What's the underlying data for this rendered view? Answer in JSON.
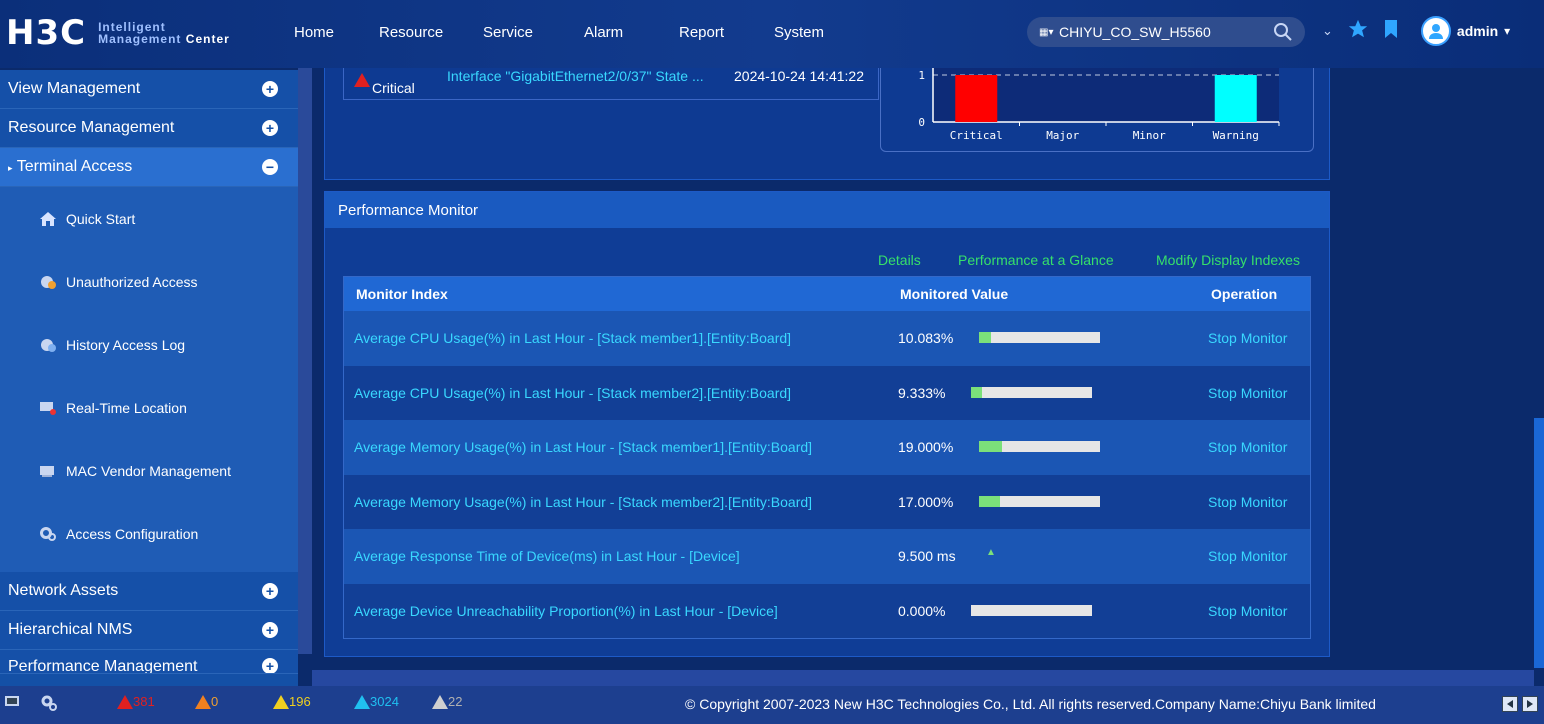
{
  "header": {
    "brand": "H3C",
    "brand_sub_line1": "Intelligent",
    "brand_sub_line2a": "Management",
    "brand_sub_line2b": "Center",
    "nav": [
      "Home",
      "Resource",
      "Service",
      "Alarm",
      "Report",
      "System"
    ],
    "device_selector": "CHIYU_CO_SW_H5560",
    "user": "admin"
  },
  "sidebar": {
    "sections": [
      "View Management",
      "Resource Management",
      "Terminal Access"
    ],
    "sub_items": [
      "Quick Start",
      "Unauthorized Access",
      "History Access Log",
      "Real-Time Location",
      "MAC Vendor Management",
      "Access Configuration"
    ],
    "bottom_sections": [
      "Network Assets",
      "Hierarchical NMS",
      "Performance Management"
    ]
  },
  "alarm_row": {
    "level": "Critical",
    "text": "Interface \"GigabitEthernet2/0/37\" State ...",
    "time": "2024-10-24 14:41:22"
  },
  "alarm_chart": {
    "categories": [
      "Critical",
      "Major",
      "Minor",
      "Warning"
    ],
    "values": [
      1,
      0,
      0,
      1
    ],
    "ticks": [
      "1",
      "0"
    ],
    "colors": {
      "Critical": "#ff0000",
      "Warning": "#00ffff"
    }
  },
  "perf": {
    "title": "Performance Monitor",
    "links": [
      "Details",
      "Performance at a Glance",
      "Modify Display Indexes"
    ],
    "columns": [
      "Monitor Index",
      "Monitored Value",
      "Operation"
    ],
    "rows": [
      {
        "index": "Average CPU Usage(%) in Last Hour - [Stack member1].[Entity:Board]",
        "value": "10.083%",
        "fraction": 0.10083,
        "op": "Stop Monitor"
      },
      {
        "index": "Average CPU Usage(%) in Last Hour - [Stack member2].[Entity:Board]",
        "value": "9.333%",
        "fraction": 0.09333,
        "op": "Stop Monitor"
      },
      {
        "index": "Average Memory Usage(%) in Last Hour - [Stack member1].[Entity:Board]",
        "value": "19.000%",
        "fraction": 0.19,
        "op": "Stop Monitor"
      },
      {
        "index": "Average Memory Usage(%) in Last Hour - [Stack member2].[Entity:Board]",
        "value": "17.000%",
        "fraction": 0.17,
        "op": "Stop Monitor"
      },
      {
        "index": "Average Response Time of Device(ms) in Last Hour - [Device]",
        "value": "9.500 ms",
        "fraction": null,
        "op": "Stop Monitor"
      },
      {
        "index": "Average Device Unreachability Proportion(%) in Last Hour - [Device]",
        "value": "0.000%",
        "fraction": 0,
        "op": "Stop Monitor"
      }
    ]
  },
  "footer": {
    "counts": [
      "381",
      "0",
      "196",
      "3024",
      "22"
    ],
    "copyright": "© Copyright 2007-2023 New H3C Technologies Co., Ltd. All rights reserved.Company Name:Chiyu Bank limited"
  }
}
